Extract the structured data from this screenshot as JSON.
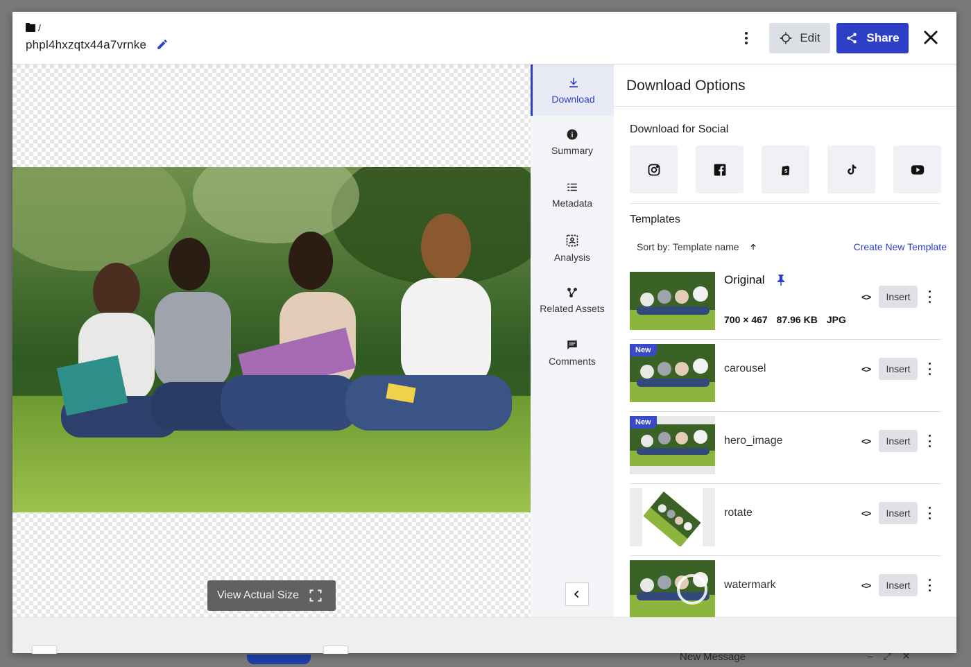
{
  "header": {
    "breadcrumb_sep": "/",
    "asset_name": "phpl4hxzqtx44a7vrnke",
    "edit_label": "Edit",
    "share_label": "Share"
  },
  "preview": {
    "view_actual_label": "View Actual Size"
  },
  "tabs": [
    {
      "label": "Download",
      "icon": "download-icon",
      "active": true
    },
    {
      "label": "Summary",
      "icon": "info-icon",
      "active": false
    },
    {
      "label": "Metadata",
      "icon": "list-icon",
      "active": false
    },
    {
      "label": "Analysis",
      "icon": "analysis-icon",
      "active": false
    },
    {
      "label": "Related Assets",
      "icon": "related-icon",
      "active": false
    },
    {
      "label": "Comments",
      "icon": "comment-icon",
      "active": false
    }
  ],
  "panel": {
    "title": "Download Options",
    "social_title": "Download for Social",
    "social": [
      "instagram-icon",
      "facebook-icon",
      "shopify-icon",
      "tiktok-icon",
      "youtube-icon"
    ],
    "templates_title": "Templates",
    "sort_label": "Sort by: Template name",
    "create_label": "Create New Template",
    "insert_label": "Insert",
    "new_badge": "New",
    "templates": [
      {
        "name": "Original",
        "dims": "700 × 467",
        "size": "87.96 KB",
        "format": "JPG",
        "pinned": true,
        "new": false
      },
      {
        "name": "carousel",
        "new": true
      },
      {
        "name": "hero_image",
        "new": true
      },
      {
        "name": "rotate",
        "new": false
      },
      {
        "name": "watermark",
        "new": false
      }
    ]
  },
  "backdrop": {
    "new_message": "New Message"
  },
  "colors": {
    "accent": "#2c3fc6",
    "edit_bg": "#dcdfe5",
    "rail_bg": "#f4f5f8"
  }
}
